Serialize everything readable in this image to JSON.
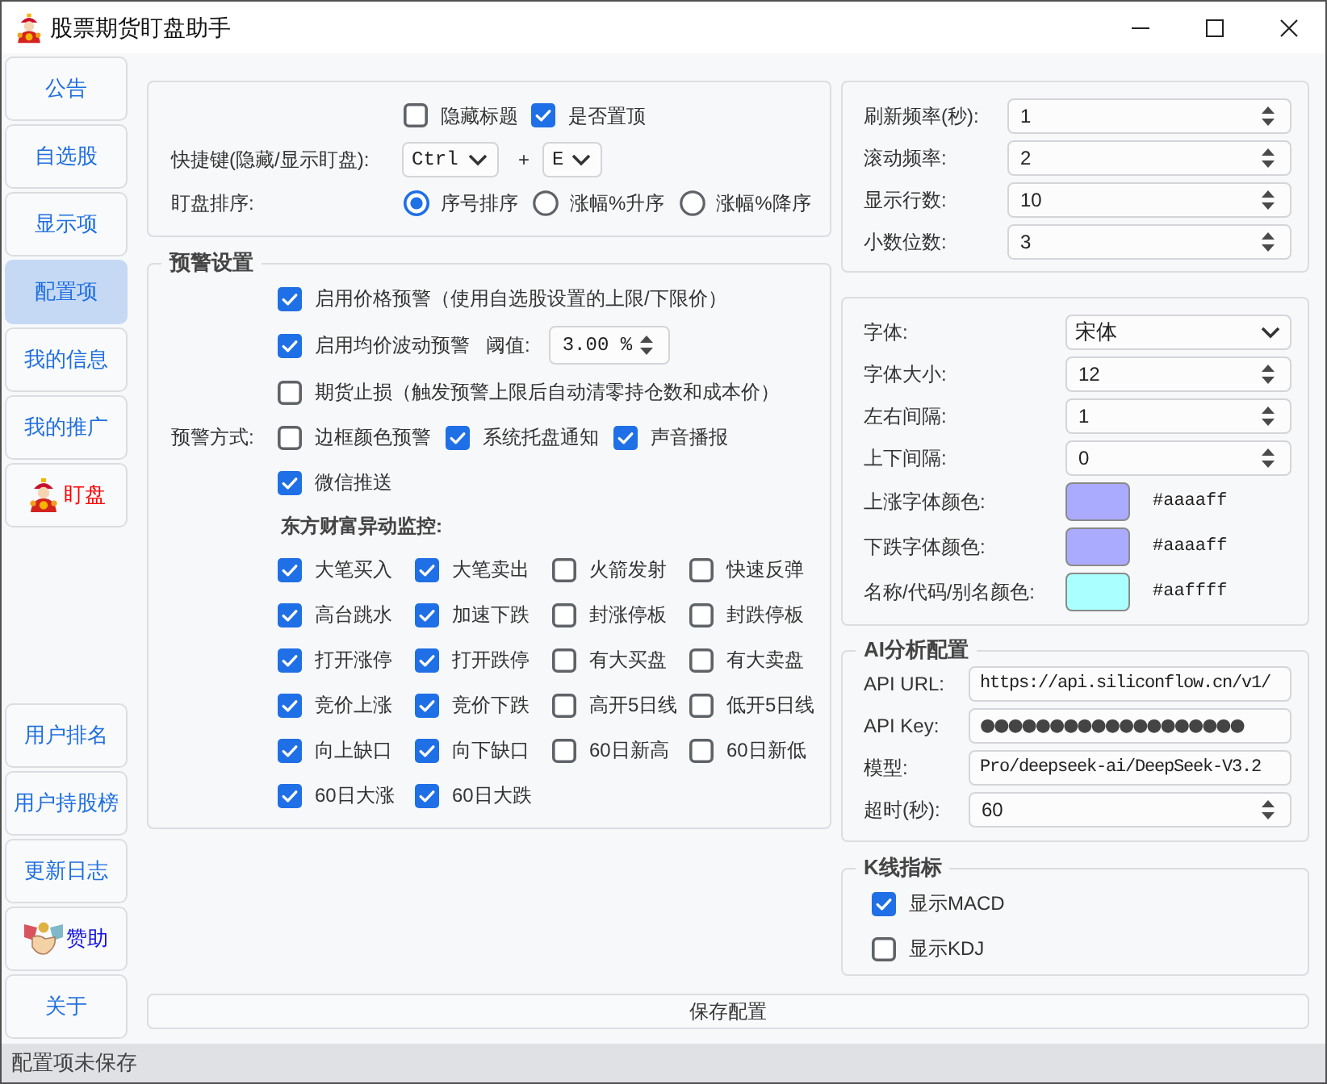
{
  "window": {
    "title": "股票期货盯盘助手"
  },
  "sidebar": {
    "top_items": [
      {
        "label": "公告",
        "kind": "text",
        "selected": false
      },
      {
        "label": "自选股",
        "kind": "text",
        "selected": false
      },
      {
        "label": "显示项",
        "kind": "text",
        "selected": false
      },
      {
        "label": "配置项",
        "kind": "text",
        "selected": true
      },
      {
        "label": "我的信息",
        "kind": "text",
        "selected": false
      },
      {
        "label": "我的推广",
        "kind": "text",
        "selected": false
      },
      {
        "label": "盯盘",
        "kind": "watch",
        "selected": false
      }
    ],
    "bottom_items": [
      {
        "label": "用户排名",
        "kind": "text",
        "selected": false
      },
      {
        "label": "用户持股榜",
        "kind": "text",
        "selected": false
      },
      {
        "label": "更新日志",
        "kind": "text",
        "selected": false
      },
      {
        "label": "赞助",
        "kind": "sponsor",
        "selected": false
      },
      {
        "label": "关于",
        "kind": "text",
        "selected": false
      }
    ]
  },
  "display_settings": {
    "checkboxes": [
      {
        "label": "隐藏标题",
        "checked": false
      },
      {
        "label": "是否置顶",
        "checked": true
      }
    ],
    "hotkey": {
      "label": "快捷键(隐藏/显示盯盘):",
      "modifier": "Ctrl",
      "separator": "+",
      "key": "E"
    },
    "sort": {
      "label": "盯盘排序:",
      "options": [
        {
          "label": "序号排序",
          "selected": true
        },
        {
          "label": "涨幅%升序",
          "selected": false
        },
        {
          "label": "涨幅%降序",
          "selected": false
        }
      ]
    }
  },
  "alert_settings": {
    "title": "预警设置",
    "options": [
      {
        "kind": "check",
        "label": "启用价格预警（使用自选股设置的上限/下限价）",
        "checked": true
      },
      {
        "kind": "threshold",
        "label": "启用均价波动预警",
        "checked": true,
        "threshold_label": "阈值:",
        "threshold": "3.00 %"
      },
      {
        "kind": "check",
        "label": "期货止损（触发预警上限后自动清零持仓数和成本价）",
        "checked": false
      }
    ],
    "methods": {
      "label": "预警方式:",
      "items": [
        {
          "label": "边框颜色预警",
          "checked": false
        },
        {
          "label": "系统托盘通知",
          "checked": true
        },
        {
          "label": "声音播报",
          "checked": true
        },
        {
          "label": "微信推送",
          "checked": true
        }
      ]
    },
    "monitor": {
      "title": "东方财富异动监控:",
      "items": [
        {
          "label": "大笔买入",
          "checked": true
        },
        {
          "label": "大笔卖出",
          "checked": true
        },
        {
          "label": "火箭发射",
          "checked": false
        },
        {
          "label": "快速反弹",
          "checked": false
        },
        {
          "label": "高台跳水",
          "checked": true
        },
        {
          "label": "加速下跌",
          "checked": true
        },
        {
          "label": "封涨停板",
          "checked": false
        },
        {
          "label": "封跌停板",
          "checked": false
        },
        {
          "label": "打开涨停",
          "checked": true
        },
        {
          "label": "打开跌停",
          "checked": true
        },
        {
          "label": "有大买盘",
          "checked": false
        },
        {
          "label": "有大卖盘",
          "checked": false
        },
        {
          "label": "竞价上涨",
          "checked": true
        },
        {
          "label": "竞价下跌",
          "checked": true
        },
        {
          "label": "高开5日线",
          "checked": false
        },
        {
          "label": "低开5日线",
          "checked": false
        },
        {
          "label": "向上缺口",
          "checked": true
        },
        {
          "label": "向下缺口",
          "checked": true
        },
        {
          "label": "60日新高",
          "checked": false
        },
        {
          "label": "60日新低",
          "checked": false
        },
        {
          "label": "60日大涨",
          "checked": true
        },
        {
          "label": "60日大跌",
          "checked": true
        }
      ]
    }
  },
  "refresh_settings": {
    "fields": [
      {
        "label": "刷新频率(秒):",
        "value": "1"
      },
      {
        "label": "滚动频率:",
        "value": "2"
      },
      {
        "label": "显示行数:",
        "value": "10"
      },
      {
        "label": "小数位数:",
        "value": "3"
      }
    ]
  },
  "font_settings": {
    "fields": [
      {
        "kind": "select",
        "label": "字体:",
        "value": "宋体"
      },
      {
        "kind": "spin",
        "label": "字体大小:",
        "value": "12"
      },
      {
        "kind": "spin",
        "label": "左右间隔:",
        "value": "1"
      },
      {
        "kind": "spin",
        "label": "上下间隔:",
        "value": "0"
      },
      {
        "kind": "color",
        "label": "上涨字体颜色:",
        "value": "#aaaaff",
        "color": "#aaaaff"
      },
      {
        "kind": "color",
        "label": "下跌字体颜色:",
        "value": "#aaaaff",
        "color": "#aaaaff"
      },
      {
        "kind": "color",
        "label": "名称/代码/别名颜色:",
        "value": "#aaffff",
        "color": "#aaffff"
      }
    ]
  },
  "ai_config": {
    "title": "AI分析配置",
    "fields": [
      {
        "kind": "text",
        "label": "API URL:",
        "value": "https://api.siliconflow.cn/v1/"
      },
      {
        "kind": "password",
        "label": "API Key:",
        "value": "●●●●●●●●●●●●●●●●●●●"
      },
      {
        "kind": "text",
        "label": "模型:",
        "value": "Pro/deepseek-ai/DeepSeek-V3.2"
      },
      {
        "kind": "spin",
        "label": "超时(秒):",
        "value": "60"
      }
    ]
  },
  "kline_settings": {
    "title": "K线指标",
    "items": [
      {
        "label": "显示MACD",
        "checked": true
      },
      {
        "label": "显示KDJ",
        "checked": false
      }
    ]
  },
  "save_button": "保存配置",
  "status_bar": "配置项未保存"
}
